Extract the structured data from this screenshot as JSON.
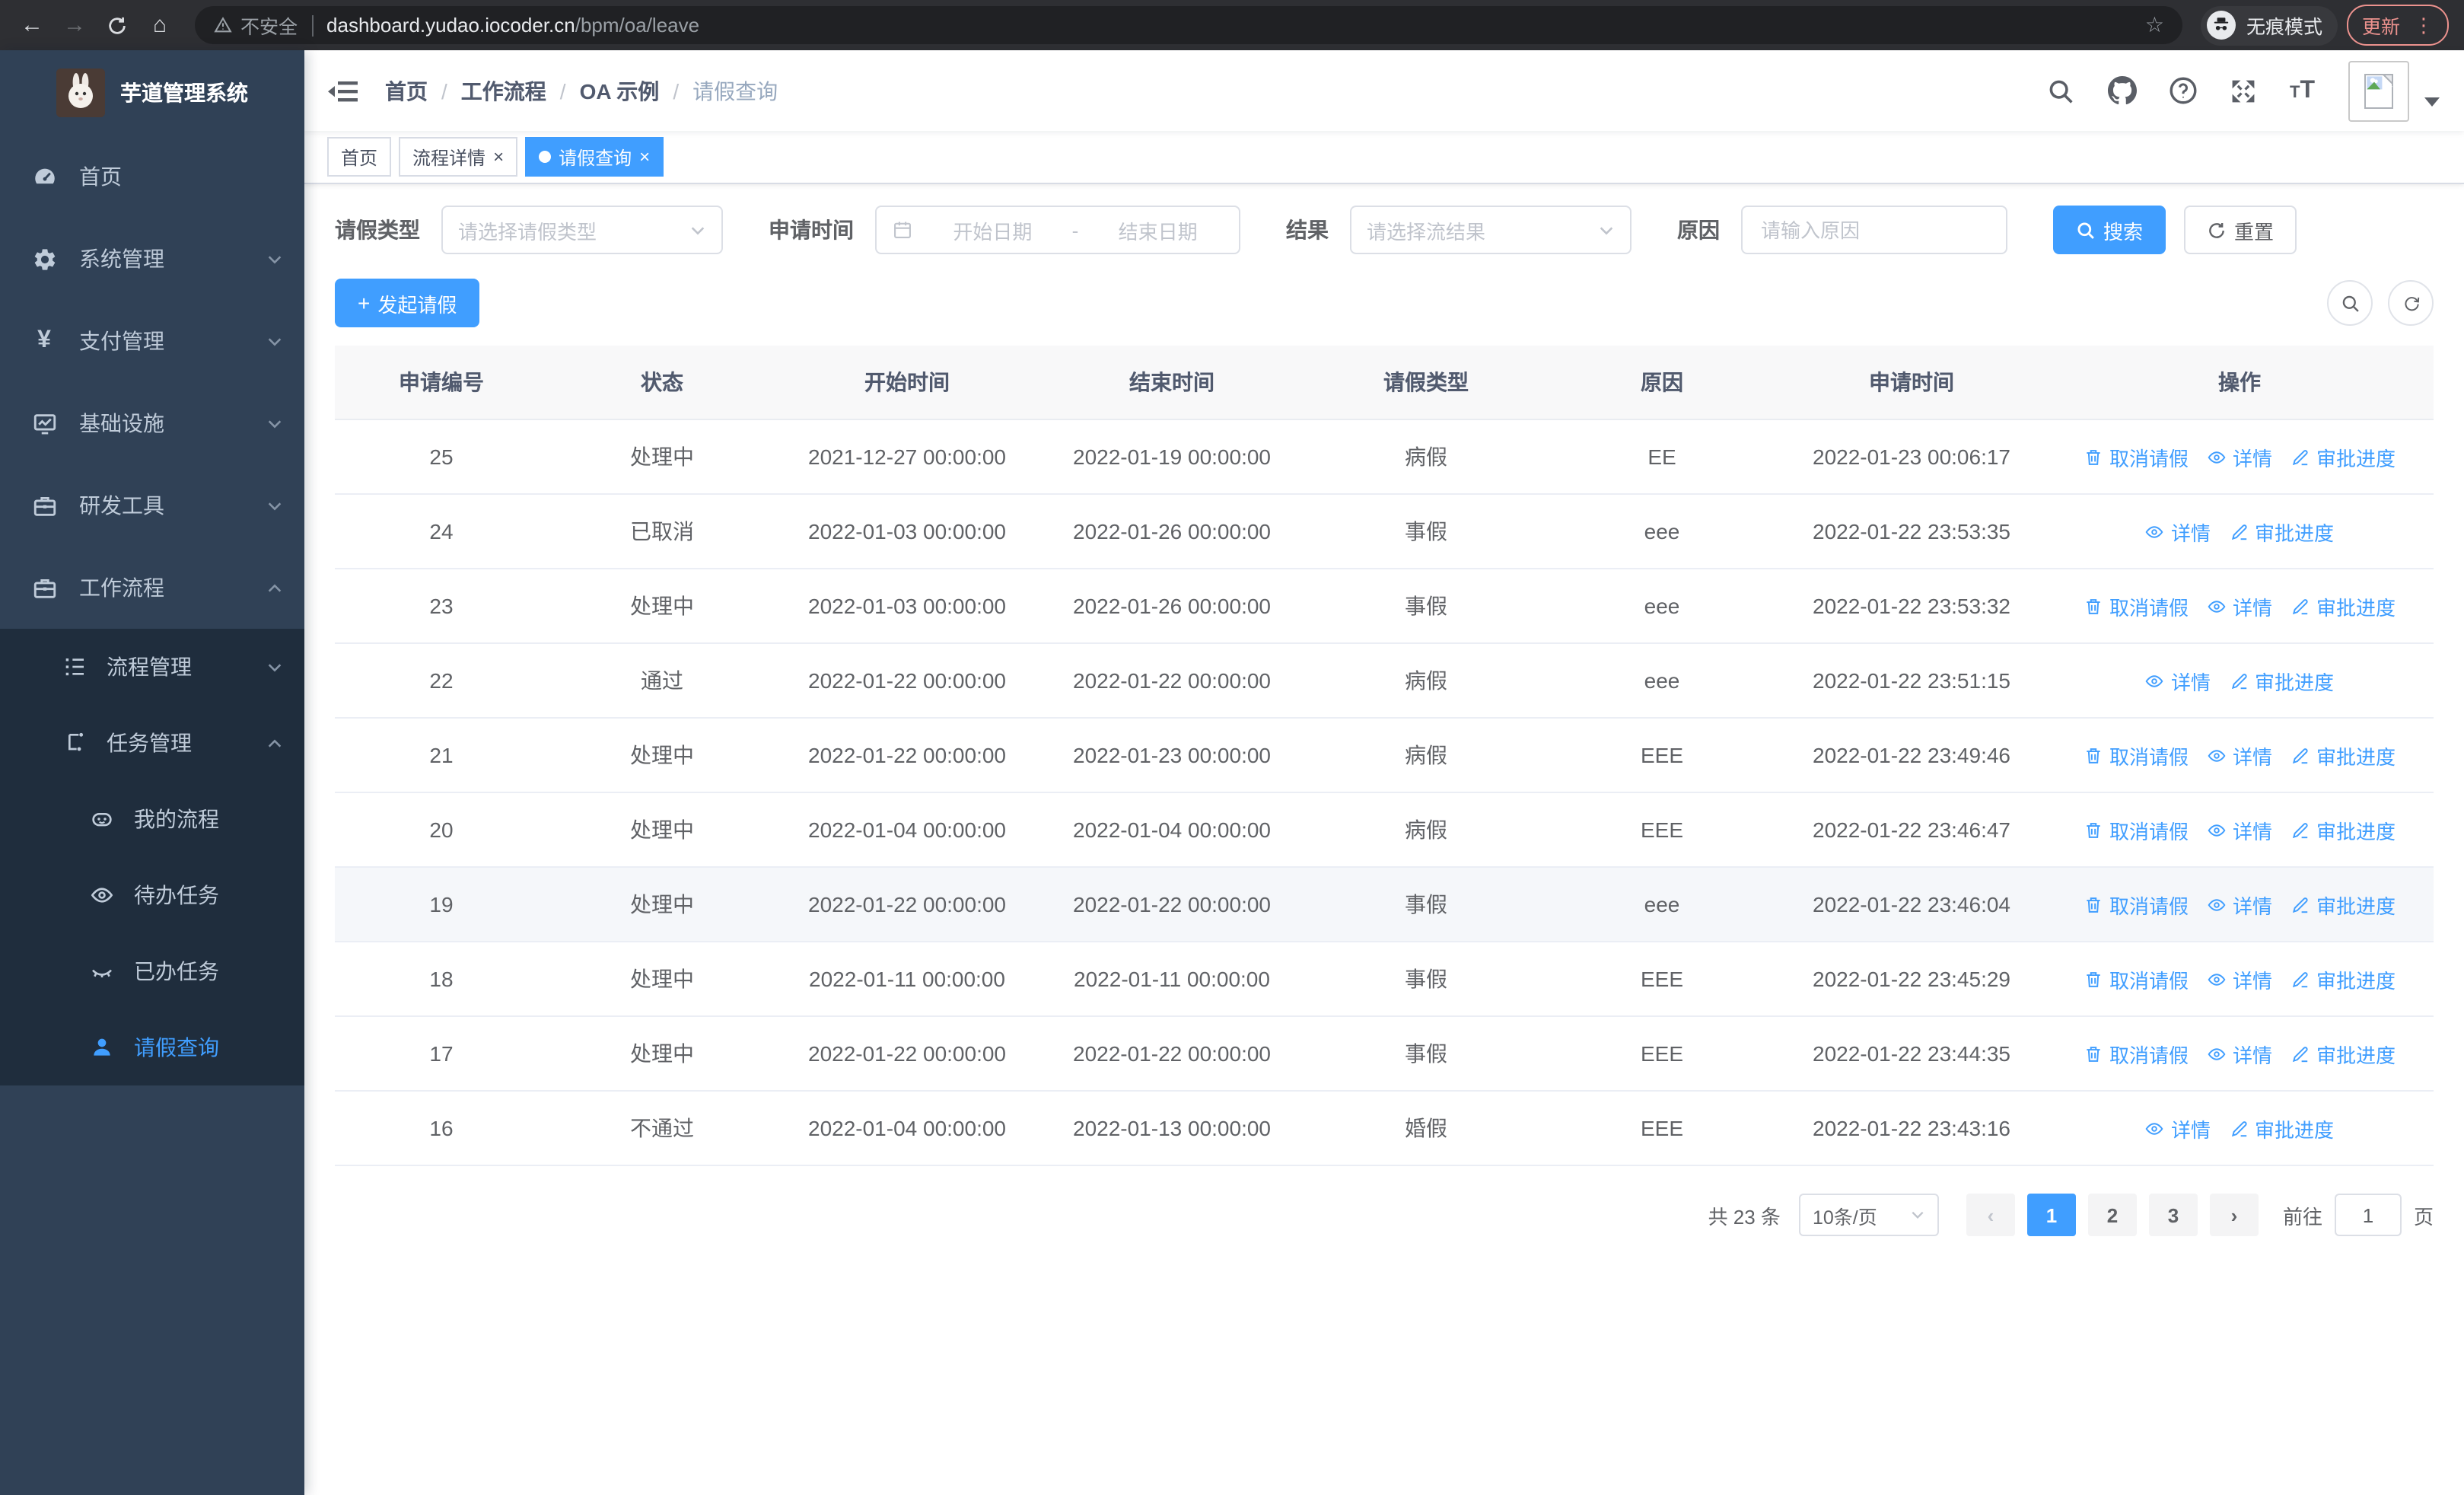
{
  "browser": {
    "security_label": "不安全",
    "url_domain": "dashboard.yudao.iocoder.cn",
    "url_path": "/bpm/oa/leave",
    "incognito_label": "无痕模式",
    "update_label": "更新"
  },
  "sidebar": {
    "title": "芋道管理系统",
    "items": [
      {
        "label": "首页",
        "icon": "dashboard-icon"
      },
      {
        "label": "系统管理",
        "icon": "gear-icon"
      },
      {
        "label": "支付管理",
        "icon": "yen-icon"
      },
      {
        "label": "基础设施",
        "icon": "monitor-icon"
      },
      {
        "label": "研发工具",
        "icon": "briefcase-icon"
      },
      {
        "label": "工作流程",
        "icon": "briefcase-icon"
      }
    ],
    "flow_group": {
      "label": "流程管理",
      "icon": "flow-list-icon"
    },
    "task_group": {
      "label": "任务管理",
      "icon": "task-icon",
      "children": [
        {
          "label": "我的流程",
          "icon": "robot-icon"
        },
        {
          "label": "待办任务",
          "icon": "eye-open-icon"
        },
        {
          "label": "已办任务",
          "icon": "eye-closed-icon"
        },
        {
          "label": "请假查询",
          "icon": "user-icon"
        }
      ]
    }
  },
  "breadcrumb": {
    "separator": "/",
    "items": [
      "首页",
      "工作流程",
      "OA 示例",
      "请假查询"
    ]
  },
  "tabs": [
    {
      "label": "首页",
      "closable": false,
      "active": false
    },
    {
      "label": "流程详情",
      "closable": true,
      "active": false
    },
    {
      "label": "请假查询",
      "closable": true,
      "active": true
    }
  ],
  "close_glyph": "×",
  "filters": {
    "leave_type": {
      "label": "请假类型",
      "placeholder": "请选择请假类型"
    },
    "apply_time": {
      "label": "申请时间",
      "start_placeholder": "开始日期",
      "separator": "-",
      "end_placeholder": "结束日期"
    },
    "result": {
      "label": "结果",
      "placeholder": "请选择流结果"
    },
    "reason": {
      "label": "原因",
      "placeholder": "请输入原因"
    },
    "search_label": "搜索",
    "reset_label": "重置"
  },
  "toolbar": {
    "create_label": "发起请假",
    "plus_glyph": "+"
  },
  "table": {
    "columns": [
      "申请编号",
      "状态",
      "开始时间",
      "结束时间",
      "请假类型",
      "原因",
      "申请时间",
      "操作"
    ],
    "action_defs": {
      "cancel": {
        "label": "取消请假",
        "icon": "trash-icon"
      },
      "detail": {
        "label": "详情",
        "icon": "eye-icon"
      },
      "progress": {
        "label": "审批进度",
        "icon": "edit-icon"
      }
    },
    "rows": [
      {
        "id": "25",
        "status": "处理中",
        "start_time": "2021-12-27 00:00:00",
        "end_time": "2022-01-19 00:00:00",
        "leave_type": "病假",
        "reason": "EE",
        "apply_time": "2022-01-23 00:06:17",
        "actions": [
          "cancel",
          "detail",
          "progress"
        ],
        "hover": false
      },
      {
        "id": "24",
        "status": "已取消",
        "start_time": "2022-01-03 00:00:00",
        "end_time": "2022-01-26 00:00:00",
        "leave_type": "事假",
        "reason": "eee",
        "apply_time": "2022-01-22 23:53:35",
        "actions": [
          "detail",
          "progress"
        ],
        "hover": false
      },
      {
        "id": "23",
        "status": "处理中",
        "start_time": "2022-01-03 00:00:00",
        "end_time": "2022-01-26 00:00:00",
        "leave_type": "事假",
        "reason": "eee",
        "apply_time": "2022-01-22 23:53:32",
        "actions": [
          "cancel",
          "detail",
          "progress"
        ],
        "hover": false
      },
      {
        "id": "22",
        "status": "通过",
        "start_time": "2022-01-22 00:00:00",
        "end_time": "2022-01-22 00:00:00",
        "leave_type": "病假",
        "reason": "eee",
        "apply_time": "2022-01-22 23:51:15",
        "actions": [
          "detail",
          "progress"
        ],
        "hover": false
      },
      {
        "id": "21",
        "status": "处理中",
        "start_time": "2022-01-22 00:00:00",
        "end_time": "2022-01-23 00:00:00",
        "leave_type": "病假",
        "reason": "EEE",
        "apply_time": "2022-01-22 23:49:46",
        "actions": [
          "cancel",
          "detail",
          "progress"
        ],
        "hover": false
      },
      {
        "id": "20",
        "status": "处理中",
        "start_time": "2022-01-04 00:00:00",
        "end_time": "2022-01-04 00:00:00",
        "leave_type": "病假",
        "reason": "EEE",
        "apply_time": "2022-01-22 23:46:47",
        "actions": [
          "cancel",
          "detail",
          "progress"
        ],
        "hover": false
      },
      {
        "id": "19",
        "status": "处理中",
        "start_time": "2022-01-22 00:00:00",
        "end_time": "2022-01-22 00:00:00",
        "leave_type": "事假",
        "reason": "eee",
        "apply_time": "2022-01-22 23:46:04",
        "actions": [
          "cancel",
          "detail",
          "progress"
        ],
        "hover": true
      },
      {
        "id": "18",
        "status": "处理中",
        "start_time": "2022-01-11 00:00:00",
        "end_time": "2022-01-11 00:00:00",
        "leave_type": "事假",
        "reason": "EEE",
        "apply_time": "2022-01-22 23:45:29",
        "actions": [
          "cancel",
          "detail",
          "progress"
        ],
        "hover": false
      },
      {
        "id": "17",
        "status": "处理中",
        "start_time": "2022-01-22 00:00:00",
        "end_time": "2022-01-22 00:00:00",
        "leave_type": "事假",
        "reason": "EEE",
        "apply_time": "2022-01-22 23:44:35",
        "actions": [
          "cancel",
          "detail",
          "progress"
        ],
        "hover": false
      },
      {
        "id": "16",
        "status": "不通过",
        "start_time": "2022-01-04 00:00:00",
        "end_time": "2022-01-13 00:00:00",
        "leave_type": "婚假",
        "reason": "EEE",
        "apply_time": "2022-01-22 23:43:16",
        "actions": [
          "detail",
          "progress"
        ],
        "hover": false
      }
    ]
  },
  "pagination": {
    "total_label": "共 23 条",
    "page_size_label": "10条/页",
    "pages": [
      "1",
      "2",
      "3"
    ],
    "active_page": "1",
    "goto_label": "前往",
    "goto_value": "1",
    "unit_label": "页"
  },
  "accent_color": "#409eff",
  "sidebar_color": "#304156",
  "submenu_color": "#1f2d3d"
}
